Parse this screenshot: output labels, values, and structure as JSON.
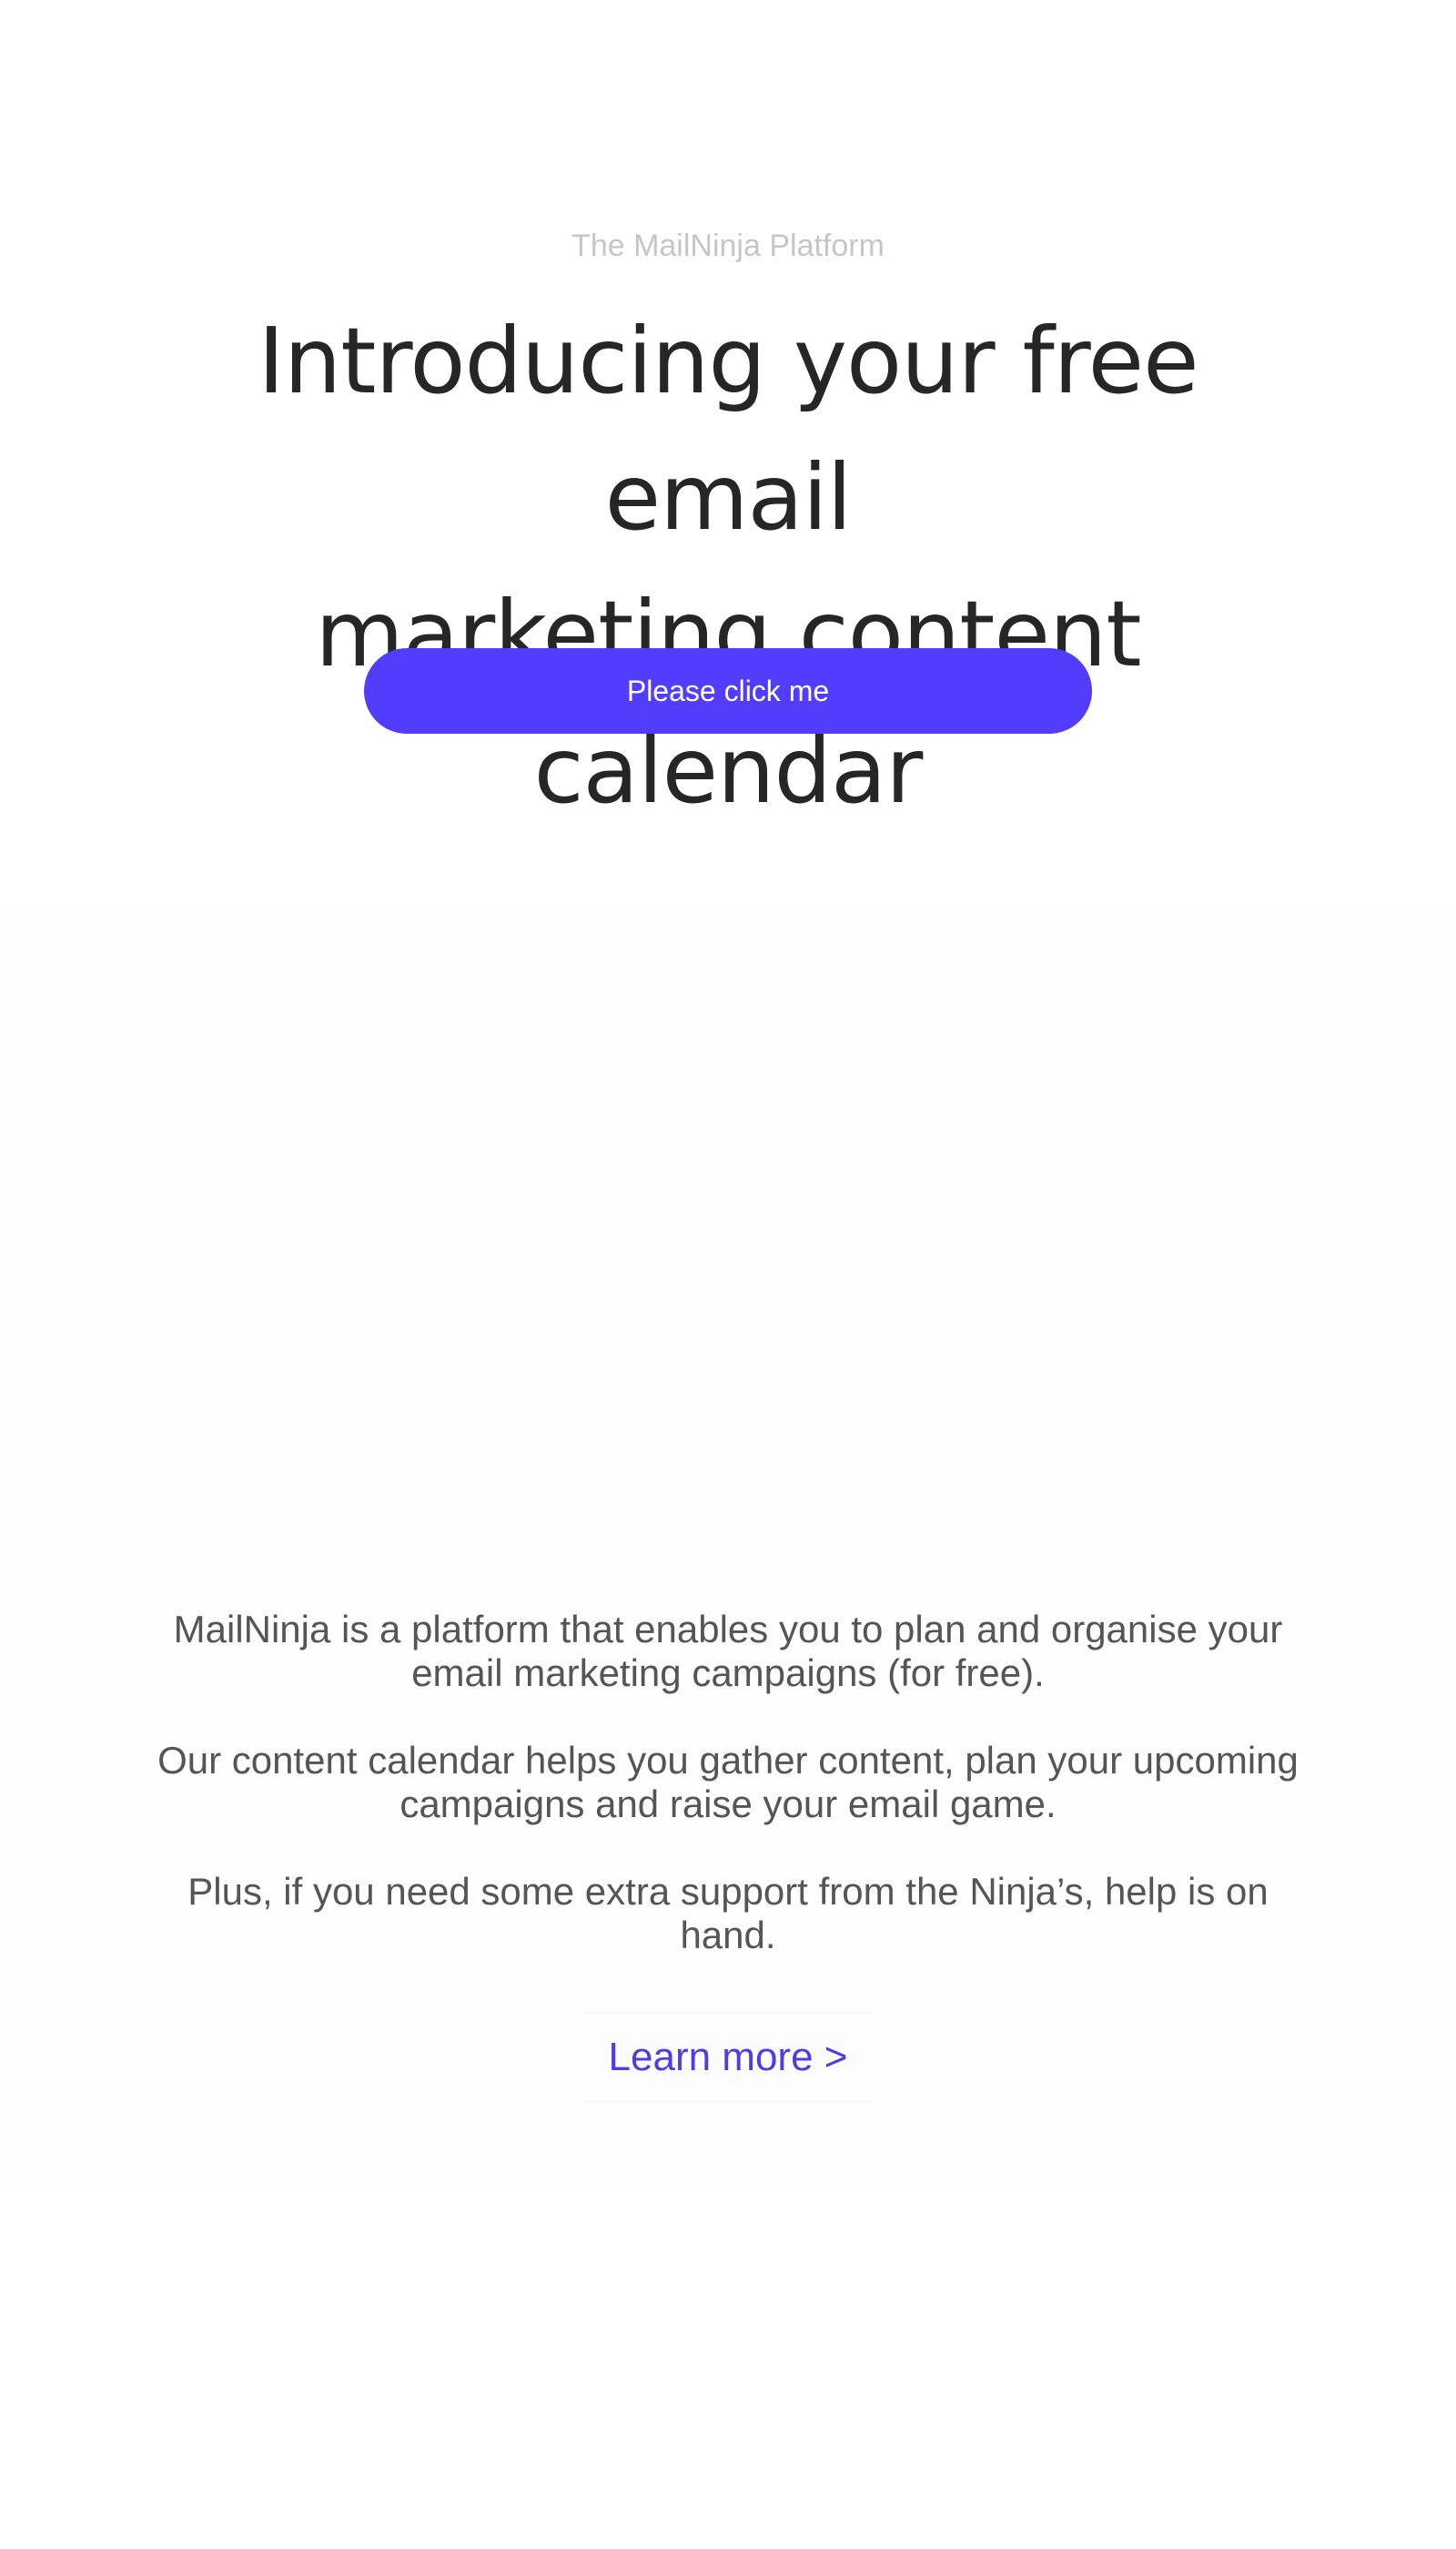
{
  "hero": {
    "eyebrow": "The MailNinja Platform",
    "headline_line1": "Introducing your free email",
    "headline_line2": "marketing content calendar",
    "cta_label": "Please click me"
  },
  "info": {
    "paragraphs": [
      "MailNinja is a platform that enables you to plan and organise your email marketing campaigns (for free).",
      "Our content calendar helps you gather content, plan your upcoming campaigns and raise your email game.",
      "Plus, if you need some extra support from the Ninja’s, help is on hand."
    ],
    "learn_more_label": "Learn more >"
  },
  "colors": {
    "accent": "#533dfd",
    "link": "#4f3ce3",
    "headline": "#262626",
    "body_text": "#555555",
    "eyebrow": "#c6c6c6"
  }
}
